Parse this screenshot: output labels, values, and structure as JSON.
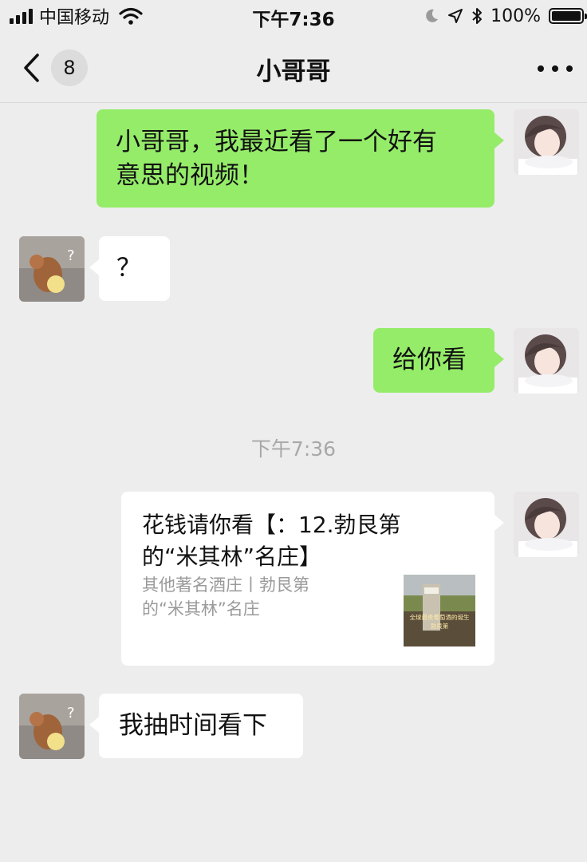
{
  "status_bar": {
    "carrier": "中国移动",
    "time": "下午7:36",
    "battery_percent": "100%"
  },
  "nav": {
    "unread_count": "8",
    "title": "小哥哥"
  },
  "messages": [
    {
      "sender": "me",
      "type": "text",
      "lines": [
        "小哥哥，我最近看了一个好有",
        "意思的视频！"
      ]
    },
    {
      "sender": "friend",
      "type": "text",
      "text": "？"
    },
    {
      "sender": "me",
      "type": "text",
      "text": "给你看"
    },
    {
      "type": "timestamp",
      "text": "下午7:36"
    },
    {
      "sender": "me",
      "type": "link",
      "title_lines": [
        "花钱请你看【：12.勃艮第",
        "的“米其林”名庄】"
      ],
      "desc_lines": [
        "其他著名酒庄丨勃艮第",
        "的“米其林”名庄"
      ],
      "thumb_caption_1": "全球最贵葡萄酒的诞生",
      "thumb_caption_2": "勃艮第"
    },
    {
      "sender": "friend",
      "type": "text",
      "text": "我抽时间看下"
    }
  ],
  "colors": {
    "background": "#ededed",
    "my_bubble": "#95ec69",
    "friend_bubble": "#ffffff",
    "timestamp_text": "#a8a8a8",
    "link_desc_text": "#9a9a9a"
  },
  "icons": {
    "back": "chevron-left-icon",
    "more": "ellipsis-icon",
    "signal": "signal-bars-icon",
    "wifi": "wifi-icon",
    "dnd": "moon-icon",
    "location": "location-arrow-icon",
    "bluetooth": "bluetooth-icon",
    "battery": "battery-icon"
  }
}
